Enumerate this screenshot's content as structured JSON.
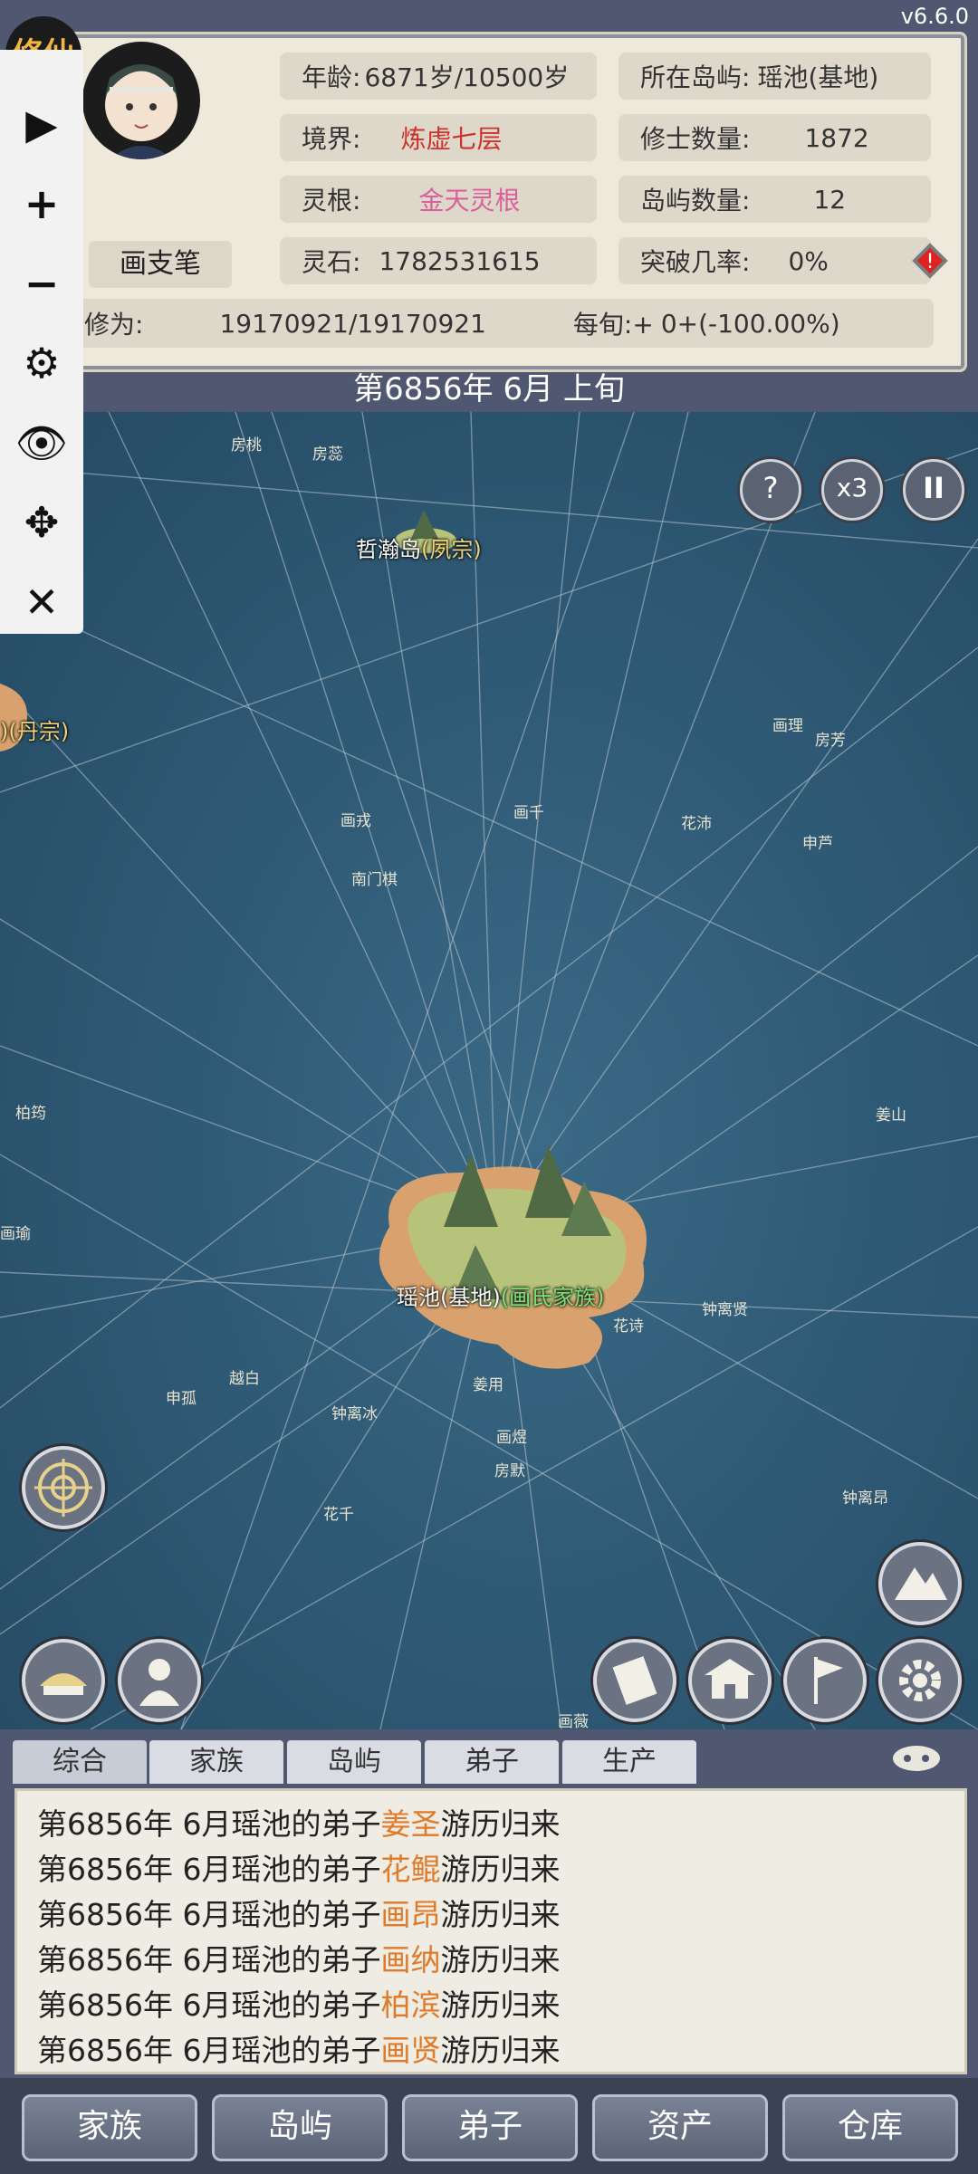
{
  "version": "v6.6.0",
  "profile": {
    "badge": "修仙",
    "name": "画支笔",
    "age_label": "年龄:",
    "age_value": "6871岁/10500岁",
    "realm_label": "境界:",
    "realm_value": "炼虚七层",
    "root_label": "灵根:",
    "root_value": "金天灵根",
    "stones_label": "灵石:",
    "stones_value": "1782531615",
    "island_label": "所在岛屿:",
    "island_value": "瑶池(基地)",
    "cultivators_label": "修士数量:",
    "cultivators_value": "1872",
    "islands_count_label": "岛屿数量:",
    "islands_count_value": "12",
    "breakthrough_label": "突破几率:",
    "breakthrough_value": "0%",
    "xiuwei_label": "修为:",
    "xiuwei_value": "19170921/19170921",
    "per_xun_label": "每旬:+",
    "per_xun_value": "0+(-100.00%)"
  },
  "date_banner": "第6856年 6月 上旬",
  "sidebar": {
    "play": "▶",
    "zoom_in": "+",
    "zoom_out": "−",
    "settings": "⚙",
    "view": "👁",
    "move": "✥",
    "close": "✕"
  },
  "map": {
    "help_label": "?",
    "speed_label": "x3",
    "pause_label": "II",
    "island_labels": {
      "zhehan_name": "哲瀚岛",
      "zhehan_sect": "(夙宗)",
      "dan_sect": ")(丹宗)",
      "yaochi_name": "瑶池(基地)",
      "yaochi_clan": "(画氏家族)"
    },
    "places": [
      "房桃",
      "房蕊",
      "画理",
      "房芳",
      "画戎",
      "画千",
      "花沛",
      "申芦",
      "南门棋",
      "柏筠",
      "姜山",
      "画瑜",
      "花诗",
      "钟离贤",
      "越白",
      "申孤",
      "姜用",
      "钟离冰",
      "画煜",
      "房默",
      "花千",
      "钟离昂",
      "画薇"
    ]
  },
  "tabs": [
    "综合",
    "家族",
    "岛屿",
    "弟子",
    "生产"
  ],
  "log": [
    {
      "prefix": "第6856年 6月瑶池的弟子",
      "name": "姜圣",
      "suffix": "游历归来"
    },
    {
      "prefix": "第6856年 6月瑶池的弟子",
      "name": "花鲲",
      "suffix": "游历归来"
    },
    {
      "prefix": "第6856年 6月瑶池的弟子",
      "name": "画昂",
      "suffix": "游历归来"
    },
    {
      "prefix": "第6856年 6月瑶池的弟子",
      "name": "画纳",
      "suffix": "游历归来"
    },
    {
      "prefix": "第6856年 6月瑶池的弟子",
      "name": "柏滨",
      "suffix": "游历归来"
    },
    {
      "prefix": "第6856年 6月瑶池的弟子",
      "name": "画贤",
      "suffix": "游历归来"
    }
  ],
  "bottom_nav": [
    "家族",
    "岛屿",
    "弟子",
    "资产",
    "仓库"
  ],
  "colors": {
    "realm": "#d0312d",
    "root": "#d9609c",
    "highlight": "#e07a2b",
    "island_sect": "#f0d37a",
    "clan": "#7ee07a"
  }
}
